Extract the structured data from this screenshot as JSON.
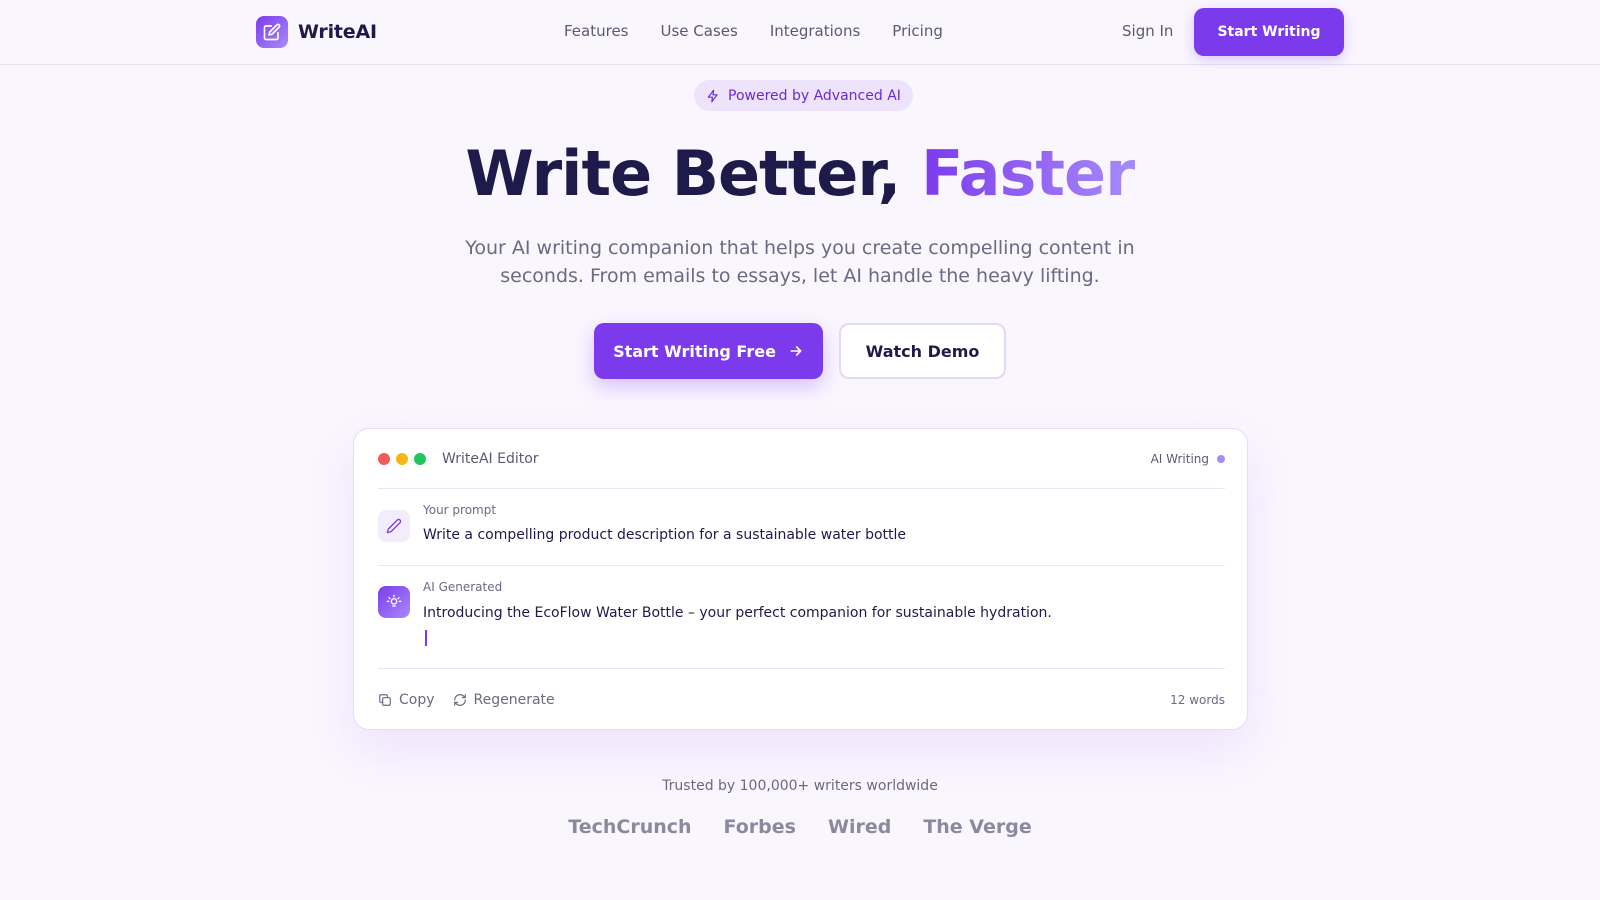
{
  "nav": {
    "logo_text": "WriteAI",
    "links": [
      "Features",
      "Use Cases",
      "Integrations",
      "Pricing"
    ],
    "sign_in": "Sign In",
    "cta": "Start Writing"
  },
  "hero": {
    "badge": "Powered by Advanced AI",
    "title_main": "Write Better, ",
    "title_accent": "Faster",
    "subtitle": "Your AI writing companion that helps you create compelling content in seconds. From emails to essays, let AI handle the heavy lifting.",
    "primary_button": "Start Writing Free",
    "secondary_button": "Watch Demo"
  },
  "editor": {
    "title": "WriteAI Editor",
    "status": "AI Writing",
    "prompt_label": "Your prompt",
    "prompt_text": "Write a compelling product description for a sustainable water bottle",
    "ai_label": "AI Generated",
    "ai_text": "Introducing the EcoFlow Water Bottle – your perfect companion for sustainable hydration.",
    "copy": "Copy",
    "regenerate": "Regenerate",
    "word_count": "12 words"
  },
  "trusted": {
    "text": "Trusted by 100,000+ writers worldwide",
    "brands": [
      "TechCrunch",
      "Forbes",
      "Wired",
      "The Verge"
    ]
  },
  "colors": {
    "accent": "#7c3aed",
    "accent_light": "#a78bfa",
    "dot_red": "#f05a5a",
    "dot_yellow": "#f5b915",
    "dot_green": "#22c55e"
  }
}
